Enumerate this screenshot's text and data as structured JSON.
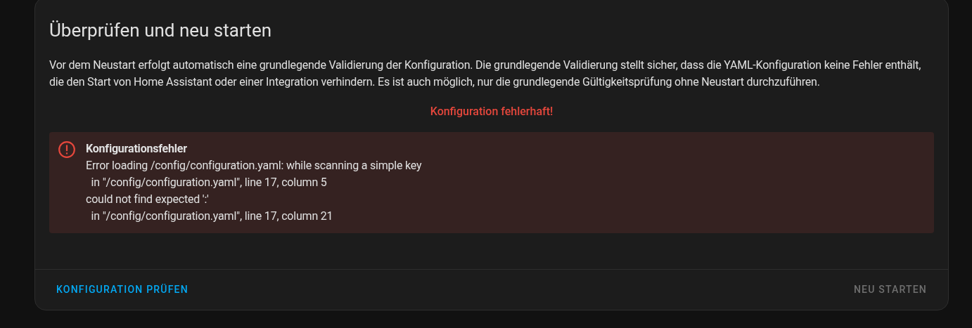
{
  "dialog": {
    "title": "Überprüfen und neu starten",
    "description": "Vor dem Neustart erfolgt automatisch eine grundlegende Validierung der Konfiguration. Die grundlegende Validierung stellt sicher, dass die YAML-Konfiguration keine Fehler enthält, die den Start von Home Assistant oder einer Integration verhindern. Es ist auch möglich, nur die grundlegende Gültigkeitsprüfung ohne Neustart durchzuführen.",
    "status": "Konfiguration fehlerhaft!",
    "alert": {
      "kind": "error",
      "title": "Konfigurationsfehler",
      "lines": [
        "Error loading /config/configuration.yaml: while scanning a simple key",
        "  in \"/config/configuration.yaml\", line 17, column 5",
        "could not find expected ':'",
        "  in \"/config/configuration.yaml\", line 17, column 21"
      ]
    },
    "actions": [
      {
        "label": "KONFIGURATION PRÜFEN",
        "disabled": false
      },
      {
        "label": "NEU STARTEN",
        "disabled": true
      }
    ]
  }
}
